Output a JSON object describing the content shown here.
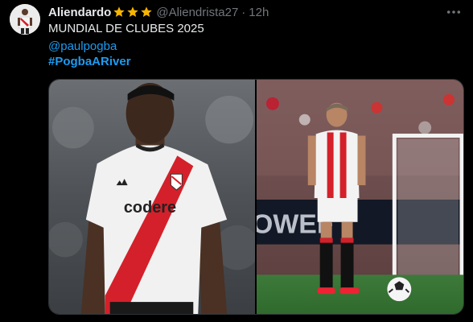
{
  "tweet": {
    "author": {
      "display_name": "Aliendardo",
      "handle": "@Aliendrista27",
      "badges": [
        "star-icon",
        "star-icon",
        "star-icon"
      ],
      "avatar": "avatar-image"
    },
    "separator": "·",
    "time": "12h",
    "more_icon": "more-icon",
    "text": {
      "line_1": "MUNDIAL DE CLUBES 2025",
      "mention": "@paulpogba",
      "hashtag": "#PogbaARiver"
    },
    "media": {
      "left_photo": {
        "description_icon": "player-photo",
        "shirt_sponsor": "codere"
      },
      "right_photo": {
        "description_icon": "player-photo",
        "board_text": "OWEF"
      }
    }
  },
  "colors": {
    "background": "#000000",
    "text_primary": "#e7e9ea",
    "text_secondary": "#71767b",
    "link": "#1d9bf0",
    "star": "#f7b500",
    "river_red": "#d4202a"
  }
}
